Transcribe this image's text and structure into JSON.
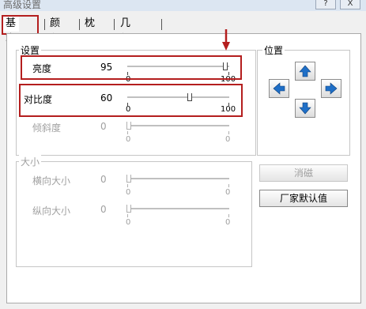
{
  "window": {
    "title": "高级设置",
    "help_button": "?",
    "close_button": "X"
  },
  "tabs": [
    {
      "label": "基本",
      "active": true
    },
    {
      "label": "颜色",
      "active": false
    },
    {
      "label": "枕形",
      "active": false
    },
    {
      "label": "几何特性",
      "active": false
    }
  ],
  "settings": {
    "title": "设置",
    "rows": [
      {
        "label": "亮度",
        "value": "95",
        "fraction": 0.95,
        "min": "0",
        "max": "100",
        "enabled": true
      },
      {
        "label": "对比度",
        "value": "60",
        "fraction": 0.6,
        "min": "0",
        "max": "100",
        "enabled": true
      },
      {
        "label": "倾斜度",
        "value": "0",
        "fraction": 0.0,
        "min": "0",
        "max": "0",
        "enabled": false
      }
    ]
  },
  "size": {
    "title": "大小",
    "rows": [
      {
        "label": "横向大小",
        "value": "0",
        "fraction": 0.0,
        "min": "0",
        "max": "0",
        "enabled": false
      },
      {
        "label": "纵向大小",
        "value": "0",
        "fraction": 0.0,
        "min": "0",
        "max": "0",
        "enabled": false
      }
    ]
  },
  "position": {
    "title": "位置",
    "icons": [
      "up-arrow-icon",
      "left-arrow-icon",
      "right-arrow-icon",
      "down-arrow-icon"
    ]
  },
  "buttons": {
    "cancel": "消磁",
    "factory_default": "厂家默认值"
  },
  "colors": {
    "highlight": "#b41e1e",
    "arrow_blue": "#1f6fc7"
  }
}
